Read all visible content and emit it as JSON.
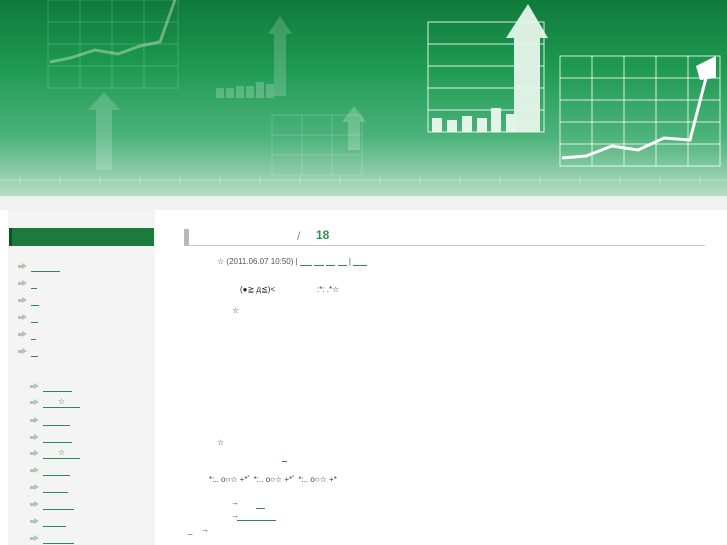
{
  "post": {
    "number": "18",
    "slash": "/",
    "meta_star": "☆",
    "meta_date": "(2011.06.07 10:50)",
    "meta_sep": "|",
    "line1_face": "(●≧ д≦)<",
    "line1_tail": ":*: .*☆",
    "line2_star": "☆",
    "line3_star": "☆",
    "sparkle_row": "*:.. o○☆ +*ﾟ *:.. o○☆ +*ﾟ *:.. o○☆ +*",
    "arrow_a": "→",
    "arrow_b": "→",
    "arrow_c": "→",
    "dash": "_"
  },
  "sidebar": {
    "sub_stars": [
      "☆",
      "☆"
    ]
  },
  "colors": {
    "brand_green": "#1a7b3c",
    "link_green": "#2e8a55"
  }
}
